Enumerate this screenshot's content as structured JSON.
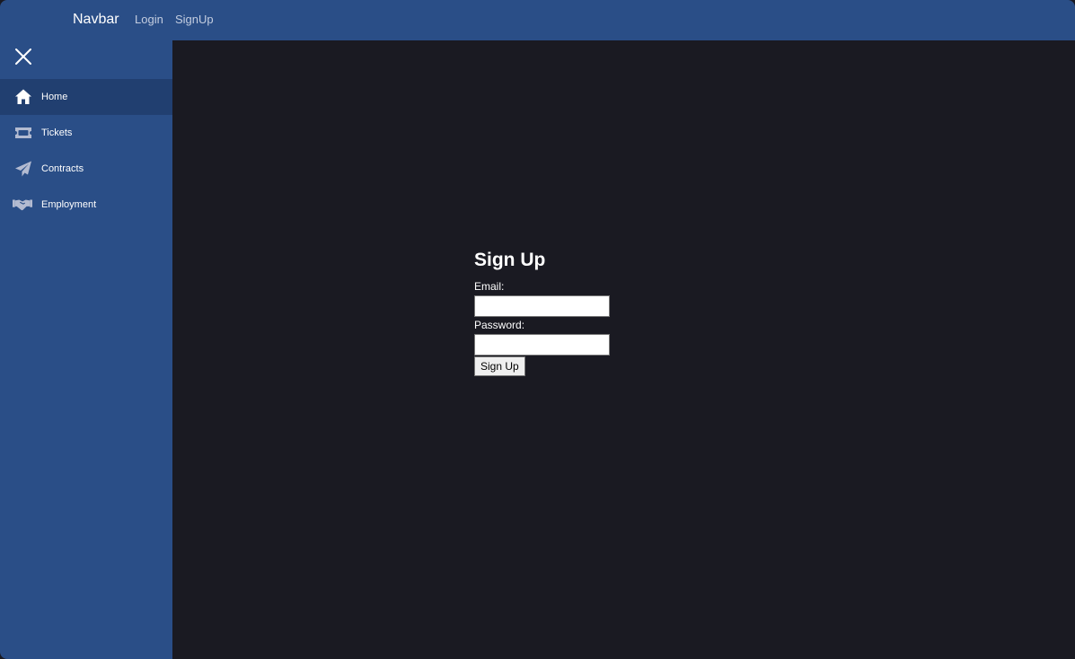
{
  "navbar": {
    "brand": "Navbar",
    "links": [
      "Login",
      "SignUp"
    ]
  },
  "sidebar": {
    "close_icon": "close-icon",
    "items": [
      {
        "label": "Home",
        "icon": "home-icon",
        "active": true
      },
      {
        "label": "Tickets",
        "icon": "ticket-icon",
        "active": false
      },
      {
        "label": "Contracts",
        "icon": "paper-plane-icon",
        "active": false
      },
      {
        "label": "Employment",
        "icon": "handshake-icon",
        "active": false
      }
    ]
  },
  "form": {
    "title": "Sign Up",
    "email_label": "Email:",
    "email_value": "",
    "password_label": "Password:",
    "password_value": "",
    "submit_label": "Sign Up"
  },
  "colors": {
    "navbar_bg": "#2a4e87",
    "sidebar_active_bg": "#213f70",
    "main_bg": "#1a1a22",
    "icon_inactive": "#b3bbd1",
    "text": "#ffffff"
  }
}
